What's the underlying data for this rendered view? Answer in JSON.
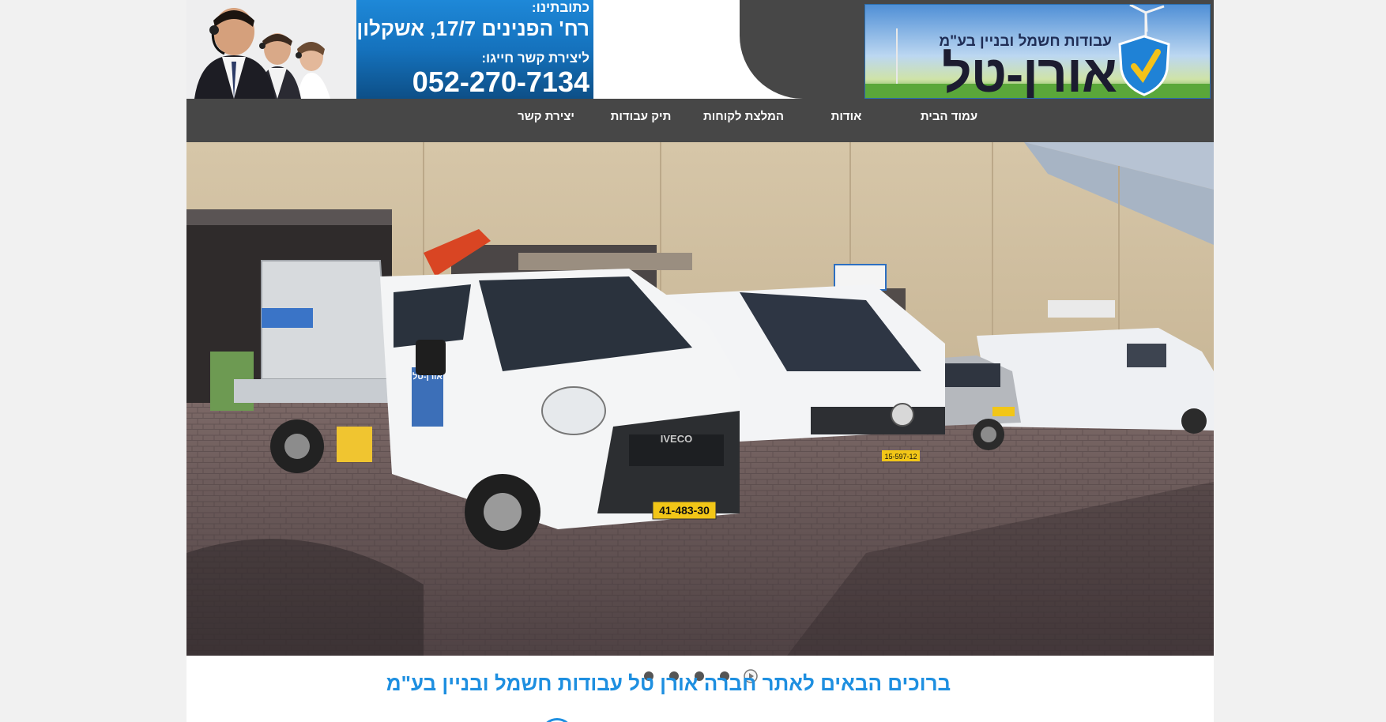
{
  "contact": {
    "address_label": "כתובתינו:",
    "address": "רח' הפנינים 17/7, אשקלון",
    "phone_label": "ליצירת קשר חייגו:",
    "phone": "052-270-7134"
  },
  "logo": {
    "subtitle": "עבודות חשמל ובניין בע\"מ",
    "name": "אורן-טל"
  },
  "nav": {
    "items": [
      {
        "label": "עמוד הבית"
      },
      {
        "label": "אודות"
      },
      {
        "label": "המלצת לקוחות"
      },
      {
        "label": "תיק עבודות"
      },
      {
        "label": "יצירת קשר"
      }
    ]
  },
  "hero": {
    "truck_plate_front": "41-483-30",
    "van_plate": "15-597-12",
    "truck_brand": "IVECO",
    "truck_decal": "אורן-טל"
  },
  "welcome": {
    "text": "ברוכים הבאים לאתר חברה אורן טל עבודות חשמל ובניין בע\"מ"
  },
  "colors": {
    "nav_bg": "#474747",
    "contact_blue": "#1572bd",
    "welcome_blue": "#1e8fe0",
    "page_bg": "#f1f1f1"
  }
}
